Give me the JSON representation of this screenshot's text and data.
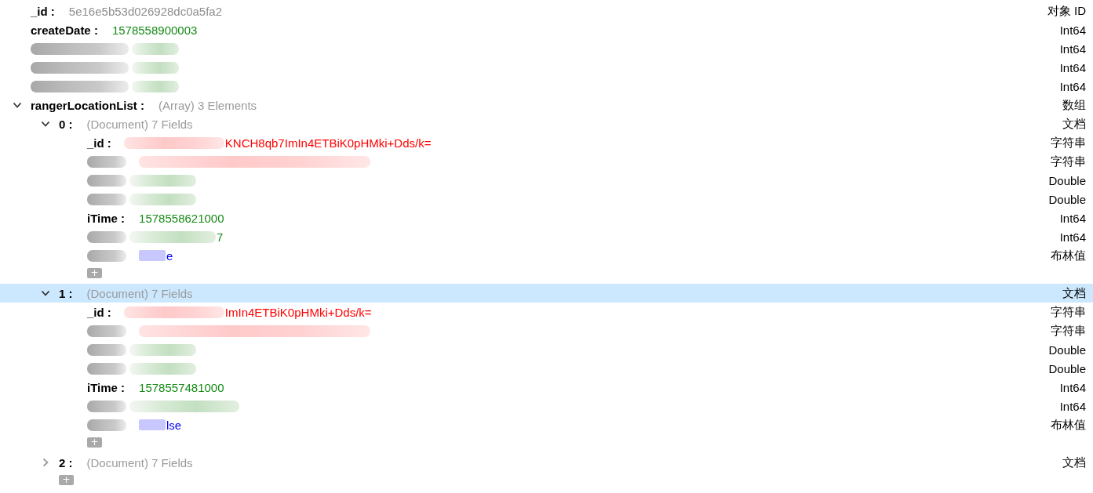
{
  "document": {
    "fields": [
      {
        "key": "_id :",
        "key_blurred": false,
        "value_blurred": false,
        "value": "5e16e5b53d026928dc0a5fa2",
        "kind": "objectid",
        "type": "对象 ID"
      },
      {
        "key": "createDate :",
        "key_blurred": false,
        "value_blurred": false,
        "value": "1578558900003",
        "kind": "number",
        "type": "Int64"
      },
      {
        "key_blurred": true,
        "value_blurred": true,
        "kind": "number",
        "type": "Int64"
      },
      {
        "key_blurred": true,
        "value_blurred": true,
        "kind": "number",
        "type": "Int64"
      },
      {
        "key_blurred": true,
        "value_blurred": true,
        "kind": "number",
        "type": "Int64"
      },
      {
        "key": "rangerLocationList :",
        "key_blurred": false,
        "value_blurred": false,
        "summary": "(Array) 3 Elements",
        "kind": "array",
        "type": "数组",
        "expanded": true,
        "add_label": "+",
        "children": [
          {
            "key": "0 :",
            "key_blurred": false,
            "value_blurred": false,
            "summary": "(Document) 7 Fields",
            "kind": "document",
            "type": "文档",
            "expanded": true,
            "selected": false,
            "add_label": "+",
            "children": [
              {
                "key": "_id :",
                "key_blurred": false,
                "value_blurred": true,
                "value": "KNCH8qb7ImIn4ETBiK0pHMki+Dds/k=",
                "kind": "string",
                "type": "字符串"
              },
              {
                "key_blurred": true,
                "value_blurred": true,
                "kind": "string",
                "type": "字符串"
              },
              {
                "key_blurred": true,
                "value_blurred": true,
                "kind": "double",
                "type": "Double"
              },
              {
                "key_blurred": true,
                "value_blurred": true,
                "kind": "double",
                "type": "Double"
              },
              {
                "key": "iTime :",
                "key_blurred": false,
                "value_blurred": false,
                "value": "1578558621000",
                "kind": "number",
                "type": "Int64"
              },
              {
                "key_blurred": true,
                "value_blurred": true,
                "value": "7",
                "kind": "number",
                "type": "Int64"
              },
              {
                "key_blurred": true,
                "value_blurred": true,
                "value": "e",
                "kind": "boolean",
                "type": "布林值"
              }
            ]
          },
          {
            "key": "1 :",
            "key_blurred": false,
            "value_blurred": false,
            "summary": "(Document) 7 Fields",
            "kind": "document",
            "type": "文档",
            "expanded": true,
            "selected": true,
            "add_label": "+",
            "children": [
              {
                "key": "_id :",
                "key_blurred": false,
                "value_blurred": true,
                "value": "ImIn4ETBiK0pHMki+Dds/k=",
                "kind": "string",
                "type": "字符串"
              },
              {
                "key_blurred": true,
                "value_blurred": true,
                "kind": "string",
                "type": "字符串"
              },
              {
                "key_blurred": true,
                "value_blurred": true,
                "kind": "double",
                "type": "Double"
              },
              {
                "key_blurred": true,
                "value_blurred": true,
                "kind": "double",
                "type": "Double"
              },
              {
                "key": "iTime :",
                "key_blurred": false,
                "value_blurred": false,
                "value": "1578557481000",
                "kind": "number",
                "type": "Int64"
              },
              {
                "key_blurred": true,
                "value_blurred": true,
                "kind": "number",
                "type": "Int64"
              },
              {
                "key_blurred": true,
                "value_blurred": true,
                "value": "lse",
                "kind": "boolean",
                "type": "布林值"
              }
            ]
          },
          {
            "key": "2 :",
            "key_blurred": false,
            "value_blurred": false,
            "summary": "(Document) 7 Fields",
            "kind": "document",
            "type": "文档",
            "expanded": false,
            "selected": false
          }
        ]
      }
    ]
  }
}
